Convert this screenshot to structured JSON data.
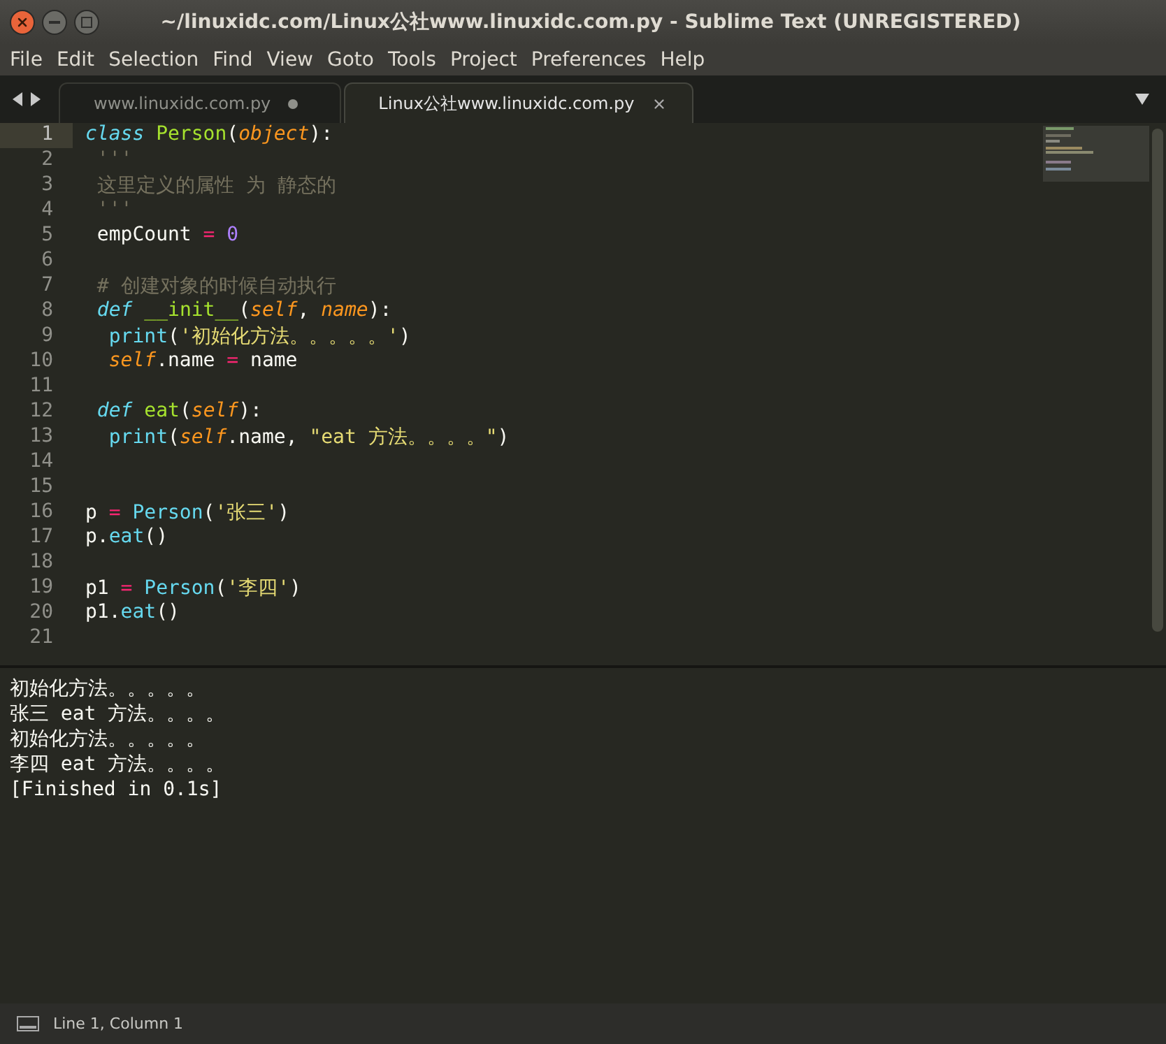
{
  "window": {
    "title": "~/linuxidc.com/Linux公社www.linuxidc.com.py - Sublime Text (UNREGISTERED)"
  },
  "menu": [
    "File",
    "Edit",
    "Selection",
    "Find",
    "View",
    "Goto",
    "Tools",
    "Project",
    "Preferences",
    "Help"
  ],
  "tabs": [
    {
      "label": "www.linuxidc.com.py",
      "selected": false,
      "modified": true
    },
    {
      "label": "Linux公社www.linuxidc.com.py",
      "selected": true,
      "modified": false
    }
  ],
  "editor": {
    "lines": [
      {
        "number": "1",
        "current": true,
        "tokens": [
          {
            "t": "class ",
            "kind": "keyword"
          },
          {
            "t": "Person",
            "kind": "name"
          },
          {
            "t": "(",
            "kind": "plain"
          },
          {
            "t": "object",
            "kind": "param"
          },
          {
            "t": "):",
            "kind": "plain"
          }
        ]
      },
      {
        "number": "2",
        "current": false,
        "tokens": [
          {
            "t": " '''",
            "kind": "comment"
          }
        ]
      },
      {
        "number": "3",
        "current": false,
        "tokens": [
          {
            "t": " 这里定义的属性 为 静态的",
            "kind": "comment"
          }
        ]
      },
      {
        "number": "4",
        "current": false,
        "tokens": [
          {
            "t": " '''",
            "kind": "comment"
          }
        ]
      },
      {
        "number": "5",
        "current": false,
        "tokens": [
          {
            "t": " empCount ",
            "kind": "plain"
          },
          {
            "t": "= ",
            "kind": "operator"
          },
          {
            "t": "0",
            "kind": "number"
          }
        ]
      },
      {
        "number": "6",
        "current": false
      },
      {
        "number": "7",
        "current": false,
        "tokens": [
          {
            "t": " # 创建对象的时候自动执行",
            "kind": "comment"
          }
        ]
      },
      {
        "number": "8",
        "current": false,
        "tokens": [
          {
            "t": " def ",
            "kind": "keyword"
          },
          {
            "t": "__init__",
            "kind": "name"
          },
          {
            "t": "(",
            "kind": "plain"
          },
          {
            "t": "self",
            "kind": "param"
          },
          {
            "t": ", ",
            "kind": "plain"
          },
          {
            "t": "name",
            "kind": "param"
          },
          {
            "t": "):",
            "kind": "plain"
          }
        ]
      },
      {
        "number": "9",
        "current": false,
        "tokens": [
          {
            "t": "  print",
            "kind": "call"
          },
          {
            "t": "(",
            "kind": "plain"
          },
          {
            "t": "'初始化方法。。。。。'",
            "kind": "string"
          },
          {
            "t": ")",
            "kind": "plain"
          }
        ]
      },
      {
        "number": "10",
        "current": false,
        "tokens": [
          {
            "t": "  self",
            "kind": "param"
          },
          {
            "t": ".name ",
            "kind": "plain"
          },
          {
            "t": "= ",
            "kind": "operator"
          },
          {
            "t": "name",
            "kind": "plain"
          }
        ]
      },
      {
        "number": "11",
        "current": false
      },
      {
        "number": "12",
        "current": false,
        "tokens": [
          {
            "t": " def ",
            "kind": "keyword"
          },
          {
            "t": "eat",
            "kind": "name"
          },
          {
            "t": "(",
            "kind": "plain"
          },
          {
            "t": "self",
            "kind": "param"
          },
          {
            "t": "):",
            "kind": "plain"
          }
        ]
      },
      {
        "number": "13",
        "current": false,
        "tokens": [
          {
            "t": "  print",
            "kind": "call"
          },
          {
            "t": "(",
            "kind": "plain"
          },
          {
            "t": "self",
            "kind": "param"
          },
          {
            "t": ".name, ",
            "kind": "plain"
          },
          {
            "t": "\"eat 方法。。。。\"",
            "kind": "string"
          },
          {
            "t": ")",
            "kind": "plain"
          }
        ]
      },
      {
        "number": "14",
        "current": false
      },
      {
        "number": "15",
        "current": false
      },
      {
        "number": "16",
        "current": false,
        "tokens": [
          {
            "t": "p ",
            "kind": "plain"
          },
          {
            "t": "= ",
            "kind": "operator"
          },
          {
            "t": "Person",
            "kind": "call"
          },
          {
            "t": "(",
            "kind": "plain"
          },
          {
            "t": "'张三'",
            "kind": "string"
          },
          {
            "t": ")",
            "kind": "plain"
          }
        ]
      },
      {
        "number": "17",
        "current": false,
        "tokens": [
          {
            "t": "p.",
            "kind": "plain"
          },
          {
            "t": "eat",
            "kind": "call"
          },
          {
            "t": "()",
            "kind": "plain"
          }
        ]
      },
      {
        "number": "18",
        "current": false
      },
      {
        "number": "19",
        "current": false,
        "tokens": [
          {
            "t": "p1 ",
            "kind": "plain"
          },
          {
            "t": "= ",
            "kind": "operator"
          },
          {
            "t": "Person",
            "kind": "call"
          },
          {
            "t": "(",
            "kind": "plain"
          },
          {
            "t": "'李四'",
            "kind": "string"
          },
          {
            "t": ")",
            "kind": "plain"
          }
        ]
      },
      {
        "number": "20",
        "current": false,
        "tokens": [
          {
            "t": "p1.",
            "kind": "plain"
          },
          {
            "t": "eat",
            "kind": "call"
          },
          {
            "t": "()",
            "kind": "plain"
          }
        ]
      },
      {
        "number": "21",
        "current": false
      }
    ]
  },
  "output": [
    "初始化方法。。。。。",
    "张三 eat 方法。。。。",
    "初始化方法。。。。。",
    "李四 eat 方法。。。。",
    "[Finished in 0.1s]"
  ],
  "status_bar": {
    "position": "Line 1, Column 1"
  }
}
